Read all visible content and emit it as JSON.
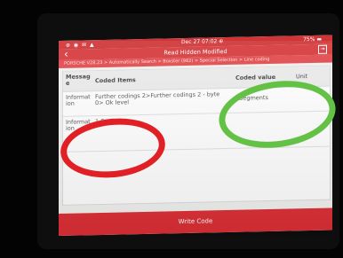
{
  "status_bar": {
    "left_icons": "⊕ ◉ ✉ ▲",
    "time": "Dec 27  07:02 ⊕",
    "right": "75% ▬"
  },
  "header": {
    "title": "Read Hidden Modified"
  },
  "breadcrumb": "PORSCHE V28.23 > Automatically Search > Boxster (982) > Special Selection > Line coding",
  "table": {
    "headers": {
      "message": "Messag e",
      "coded_items": "Coded Items",
      "coded_value": "Coded value",
      "unit": "Unit"
    },
    "rows": [
      {
        "message": "Informat ion",
        "item": "Further codings 2>Further codings 2 - byte 0> Ok level",
        "value": "4 Segments"
      },
      {
        "message": "Informat ion",
        "item": "1 Segment",
        "value": ""
      }
    ]
  },
  "write_button": "Write Code",
  "annotations": {
    "red_circle": "#e02024",
    "green_circle": "#63c146"
  },
  "colors": {
    "accent_red": "#d63a3d"
  }
}
